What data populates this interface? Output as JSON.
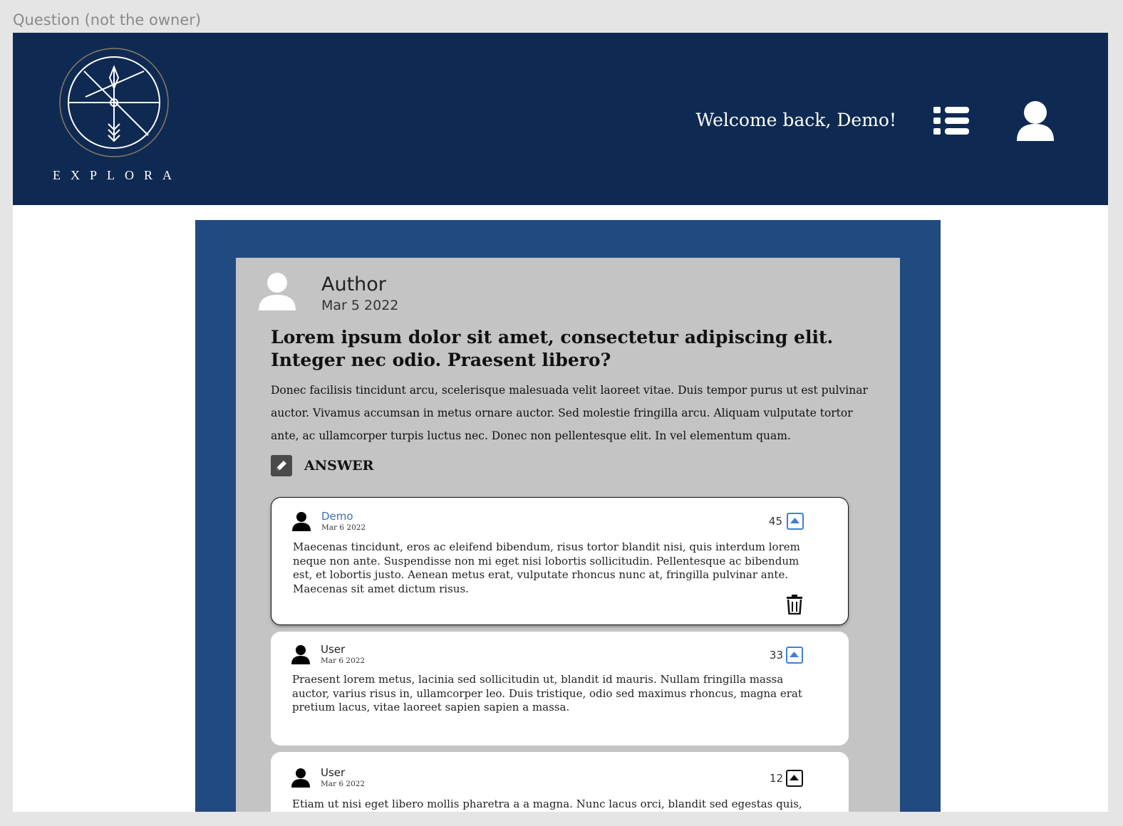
{
  "frame_label": "Question (not the owner)",
  "header": {
    "logo_text": "EXPLORA",
    "welcome": "Welcome back, Demo!",
    "menu_icon": "list-icon",
    "profile_icon": "user-icon",
    "background": "#0f2a52"
  },
  "question": {
    "author": "Author",
    "date": "Mar 5 2022",
    "title": "Lorem ipsum dolor sit amet, consectetur adipiscing elit. Integer nec odio. Praesent libero?",
    "body": "Donec facilisis tincidunt arcu, scelerisque malesuada velit laoreet vitae. Duis tempor purus ut est pulvinar auctor. Vivamus accumsan in metus ornare auctor. Sed molestie fringilla arcu. Aliquam vulputate tortor ante, ac ullamcorper turpis luctus nec. Donec non pellentesque elit. In vel elementum quam.",
    "answer_label": "ANSWER"
  },
  "answers": [
    {
      "name": "Demo",
      "date": "Mar 6 2022",
      "votes": "45",
      "body": "Maecenas tincidunt, eros ac eleifend bibendum, risus tortor blandit nisi, quis interdum lorem neque non ante. Suspendisse non mi eget nisi lobortis sollicitudin. Pellentesque ac bibendum est, et lobortis justo. Aenean metus erat, vulputate rhoncus nunc at, fringilla pulvinar ante. Maecenas sit amet dictum risus.",
      "upvoted": true,
      "owner": true
    },
    {
      "name": "User",
      "date": "Mar 6 2022",
      "votes": "33",
      "body": "Praesent lorem metus, lacinia sed sollicitudin ut, blandit id mauris. Nullam fringilla massa auctor, varius risus in, ullamcorper leo. Duis tristique, odio sed maximus rhoncus, magna erat pretium lacus, vitae laoreet sapien sapien a massa.",
      "upvoted": true,
      "owner": false
    },
    {
      "name": "User",
      "date": "Mar 6 2022",
      "votes": "12",
      "body": "Etiam ut nisi eget libero mollis pharetra a a magna. Nunc lacus orci, blandit sed egestas quis, feugiat eu",
      "upvoted": false,
      "owner": false
    }
  ],
  "colors": {
    "page_bg": "#e5e5e5",
    "outer_panel": "#204a80",
    "question_panel": "#c4c4c4",
    "upvote_active": "#3f7fd6",
    "link": "#3d6fb0"
  }
}
